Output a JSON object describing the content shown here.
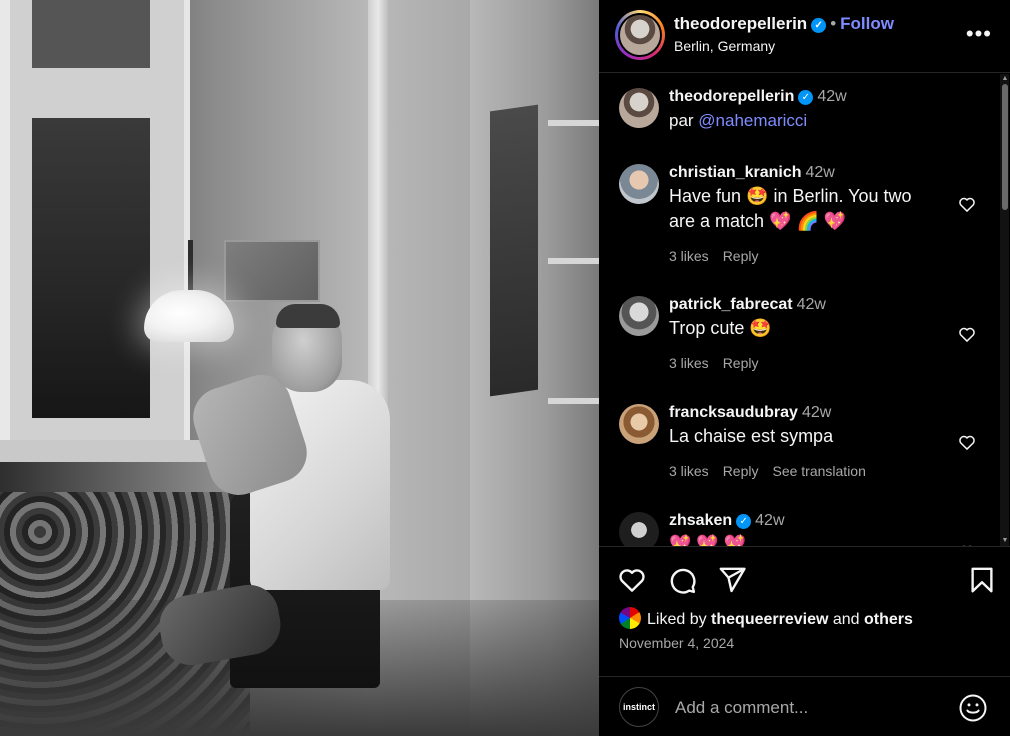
{
  "post": {
    "image_alt": "Black and white photo of a man seated at a table beside a pendant lamp in a room"
  },
  "header": {
    "username": "theodorepellerin",
    "follow_label": "Follow",
    "separator": "•",
    "location": "Berlin, Germany",
    "more_label": "•••"
  },
  "caption": {
    "username": "theodorepellerin",
    "time": "42w",
    "text_prefix": "par ",
    "mention": "@nahemaricci"
  },
  "comments": [
    {
      "username": "christian_kranich",
      "time": "42w",
      "line1": "Have fun 🤩 in Berlin. You two",
      "line2": "are a match 💖 🌈 💖",
      "likes": "3 likes",
      "reply": "Reply"
    },
    {
      "username": "patrick_fabrecat",
      "time": "42w",
      "text": "Trop cute 🤩",
      "likes": "3 likes",
      "reply": "Reply"
    },
    {
      "username": "francksaudubray",
      "time": "42w",
      "text": "La chaise est sympa",
      "likes": "3 likes",
      "reply": "Reply",
      "translate": "See translation"
    },
    {
      "username": "zhsaken",
      "time": "42w",
      "text": "💖 💖 💖"
    }
  ],
  "likes": {
    "prefix": "Liked by ",
    "user": "thequeerreview",
    "middle": " and ",
    "others": "others"
  },
  "date": "November 4, 2024",
  "add_comment": {
    "placeholder": "Add a comment...",
    "me_label": "instinct"
  },
  "colors": {
    "accent": "#7e8cff",
    "verified": "#0095f6",
    "muted": "#a8a8a8"
  },
  "icons": [
    "heart-icon",
    "comment-icon",
    "share-icon",
    "bookmark-icon",
    "emoji-icon",
    "verified-icon"
  ]
}
